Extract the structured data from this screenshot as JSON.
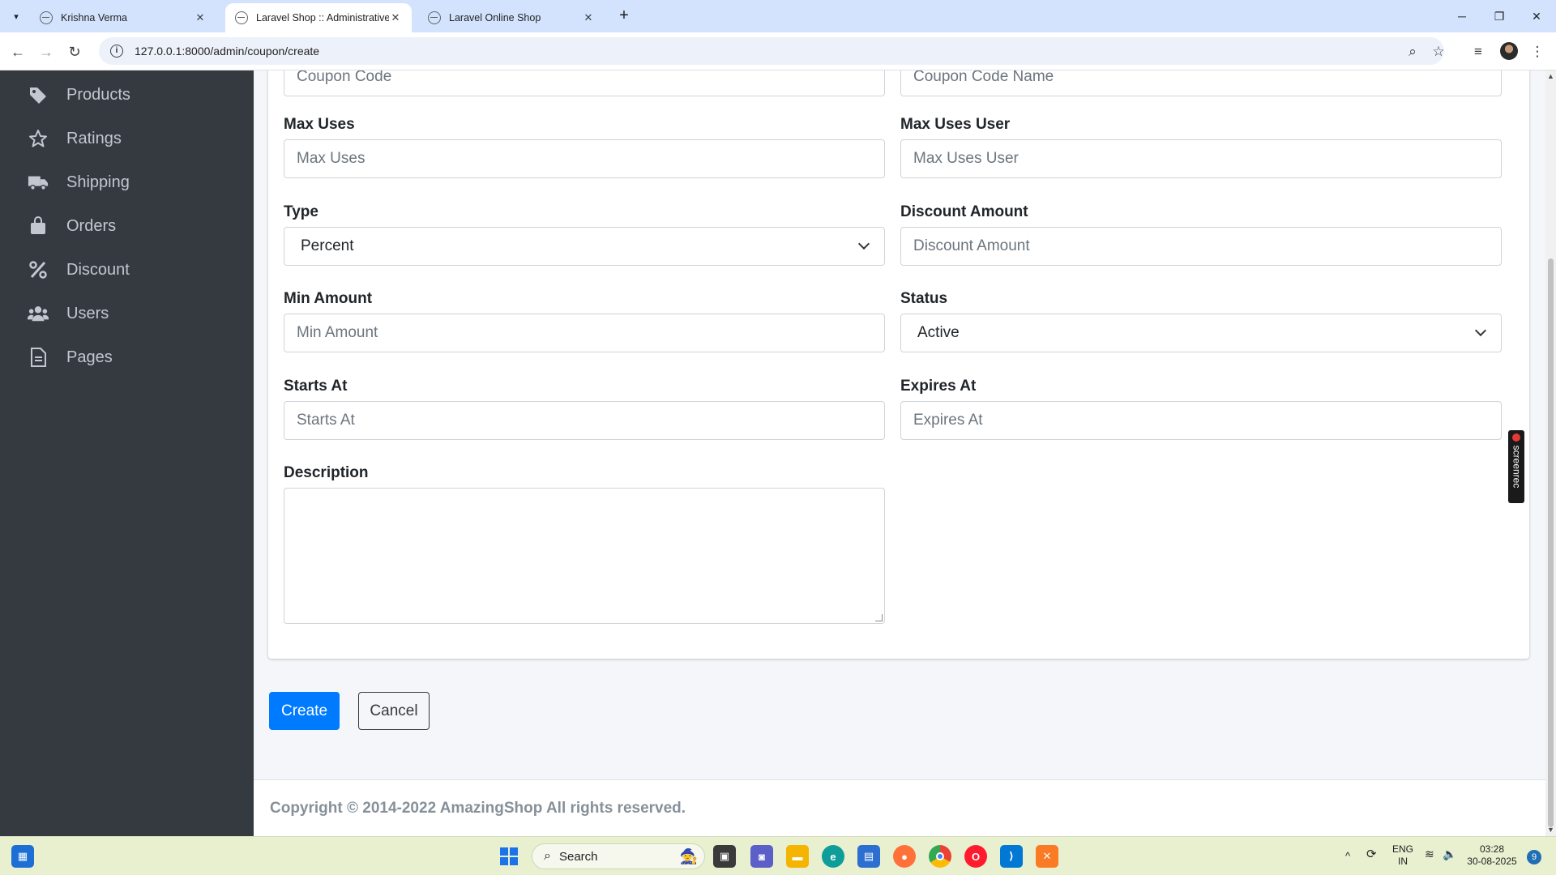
{
  "browser": {
    "tabs": [
      {
        "title": "Krishna Verma",
        "active": false
      },
      {
        "title": "Laravel Shop :: Administrative P",
        "active": true
      },
      {
        "title": "Laravel Online Shop",
        "active": false
      }
    ],
    "url": "127.0.0.1:8000/admin/coupon/create"
  },
  "sidebar": {
    "items": [
      {
        "label": "Products",
        "icon": "tag-icon"
      },
      {
        "label": "Ratings",
        "icon": "star-icon"
      },
      {
        "label": "Shipping",
        "icon": "truck-icon"
      },
      {
        "label": "Orders",
        "icon": "shopping-bag-icon"
      },
      {
        "label": "Discount",
        "icon": "percent-icon"
      },
      {
        "label": "Users",
        "icon": "users-icon"
      },
      {
        "label": "Pages",
        "icon": "file-icon"
      }
    ]
  },
  "form": {
    "code_placeholder": "Coupon Code",
    "name_placeholder": "Coupon Code Name",
    "max_uses_label": "Max Uses",
    "max_uses_placeholder": "Max Uses",
    "max_uses_user_label": "Max Uses User",
    "max_uses_user_placeholder": "Max Uses User",
    "type_label": "Type",
    "type_value": "Percent",
    "discount_amount_label": "Discount Amount",
    "discount_amount_placeholder": "Discount Amount",
    "min_amount_label": "Min Amount",
    "min_amount_placeholder": "Min Amount",
    "status_label": "Status",
    "status_value": "Active",
    "starts_at_label": "Starts At",
    "starts_at_placeholder": "Starts At",
    "expires_at_label": "Expires At",
    "expires_at_placeholder": "Expires At",
    "description_label": "Description"
  },
  "actions": {
    "create_label": "Create",
    "cancel_label": "Cancel"
  },
  "footer": {
    "copyright": "Copyright © 2014-2022 AmazingShop All rights reserved."
  },
  "overlay": {
    "screenrec_label": "screenrec"
  },
  "taskbar": {
    "search_label": "Search",
    "lang_line1": "ENG",
    "lang_line2": "IN",
    "time": "03:28",
    "date": "30-08-2025",
    "notification_count": "9"
  },
  "colors": {
    "sidebar_bg": "#343a40",
    "primary": "#007bff",
    "tabbar_bg": "#d3e3fd"
  }
}
